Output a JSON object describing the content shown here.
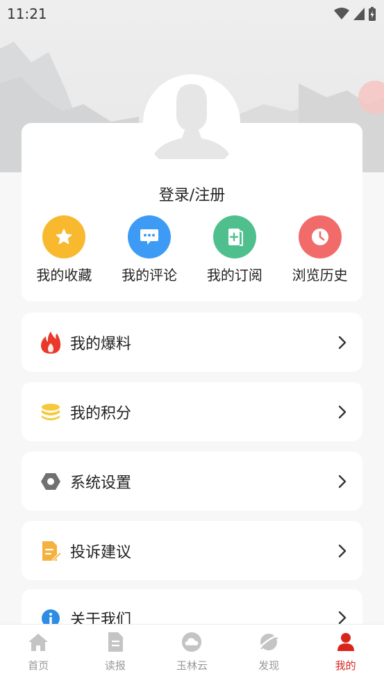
{
  "status_bar": {
    "time": "11:21"
  },
  "profile": {
    "login_label": "登录/注册"
  },
  "quick_actions": [
    {
      "label": "我的收藏",
      "icon": "star-icon",
      "color": "#f9b92f"
    },
    {
      "label": "我的评论",
      "icon": "comment-icon",
      "color": "#3d9bf5"
    },
    {
      "label": "我的订阅",
      "icon": "subscribe-icon",
      "color": "#4fc08d"
    },
    {
      "label": "浏览历史",
      "icon": "clock-icon",
      "color": "#f26b6b"
    }
  ],
  "menu": [
    {
      "label": "我的爆料",
      "icon": "fire-icon"
    },
    {
      "label": "我的积分",
      "icon": "coins-icon"
    },
    {
      "label": "系统设置",
      "icon": "settings-icon"
    },
    {
      "label": "投诉建议",
      "icon": "feedback-icon"
    },
    {
      "label": "关于我们",
      "icon": "info-icon"
    }
  ],
  "tabs": [
    {
      "label": "首页",
      "icon": "home-icon"
    },
    {
      "label": "读报",
      "icon": "newspaper-icon"
    },
    {
      "label": "玉林云",
      "icon": "cloud-icon"
    },
    {
      "label": "发现",
      "icon": "planet-icon"
    },
    {
      "label": "我的",
      "icon": "user-icon",
      "active": true
    }
  ],
  "colors": {
    "accent": "#d9241b",
    "fire": "#e8392b",
    "coins": "#f7c93a",
    "settings": "#707070",
    "feedback": "#f4b13d",
    "info": "#2d8de5"
  }
}
